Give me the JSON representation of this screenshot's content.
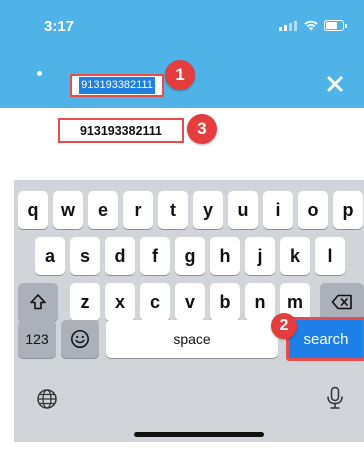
{
  "status_bar": {
    "time": "3:17"
  },
  "search_bar": {
    "query": "913193382111"
  },
  "suggestion": {
    "text": "913193382111"
  },
  "callouts": {
    "one": "1",
    "two": "2",
    "three": "3"
  },
  "keyboard": {
    "row1": [
      "q",
      "w",
      "e",
      "r",
      "t",
      "y",
      "u",
      "i",
      "o",
      "p"
    ],
    "row2": [
      "a",
      "s",
      "d",
      "f",
      "g",
      "h",
      "j",
      "k",
      "l"
    ],
    "row3": [
      "z",
      "x",
      "c",
      "v",
      "b",
      "n",
      "m"
    ],
    "numbers_label": "123",
    "space_label": "space",
    "search_label": "search"
  },
  "colors": {
    "header_bg": "#4fb3e8",
    "highlight": "#1f7fe0",
    "annotation_red": "#e53d3d",
    "keyboard_bg": "#d1d4d9"
  },
  "icons": {
    "close": "close-icon",
    "shift": "shift-icon",
    "delete": "backspace-icon",
    "emoji": "emoji-icon",
    "globe": "globe-icon",
    "mic": "microphone-icon"
  }
}
